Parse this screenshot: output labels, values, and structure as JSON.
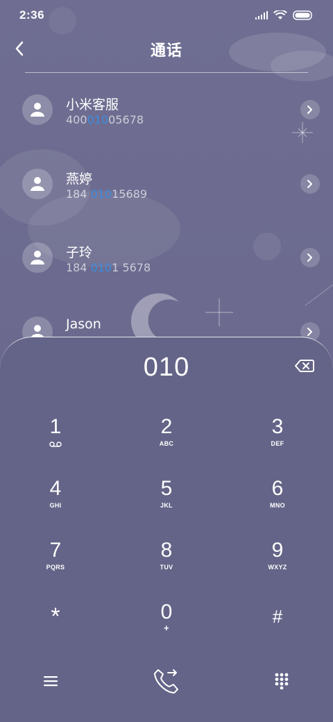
{
  "status_bar": {
    "time": "2:36",
    "icons": [
      "signal-icon",
      "wifi-icon",
      "battery-icon"
    ]
  },
  "header": {
    "title": "通话",
    "back_icon": "chevron-left-icon"
  },
  "results": [
    {
      "name": "小米客服",
      "number_pre": "400",
      "number_match": "010",
      "number_post": "05678"
    },
    {
      "name": "燕婷",
      "number_pre": "184 ",
      "number_match": "010",
      "number_post": "15689"
    },
    {
      "name": "子玲",
      "number_pre": "184 ",
      "number_match": "010",
      "number_post": "1 5678"
    },
    {
      "name": "Jason",
      "number_pre": "",
      "number_match": "",
      "number_post": ""
    }
  ],
  "dialer": {
    "input": "010",
    "keys": [
      {
        "digit": "1",
        "letters": "",
        "icon": "voicemail-icon"
      },
      {
        "digit": "2",
        "letters": "ABC"
      },
      {
        "digit": "3",
        "letters": "DEF"
      },
      {
        "digit": "4",
        "letters": "GHI"
      },
      {
        "digit": "5",
        "letters": "JKL"
      },
      {
        "digit": "6",
        "letters": "MNO"
      },
      {
        "digit": "7",
        "letters": "PQRS"
      },
      {
        "digit": "8",
        "letters": "TUV"
      },
      {
        "digit": "9",
        "letters": "WXYZ"
      },
      {
        "digit": "*",
        "letters": ""
      },
      {
        "digit": "0",
        "letters": "+"
      },
      {
        "digit": "#",
        "letters": ""
      }
    ]
  },
  "bottom_bar": {
    "left_icon": "menu-icon",
    "center_icon": "call-icon",
    "right_icon": "dialpad-icon"
  },
  "colors": {
    "highlight": "#3a8de0",
    "dialer_bg": "#646488",
    "page_bg": "#6f6e92"
  }
}
